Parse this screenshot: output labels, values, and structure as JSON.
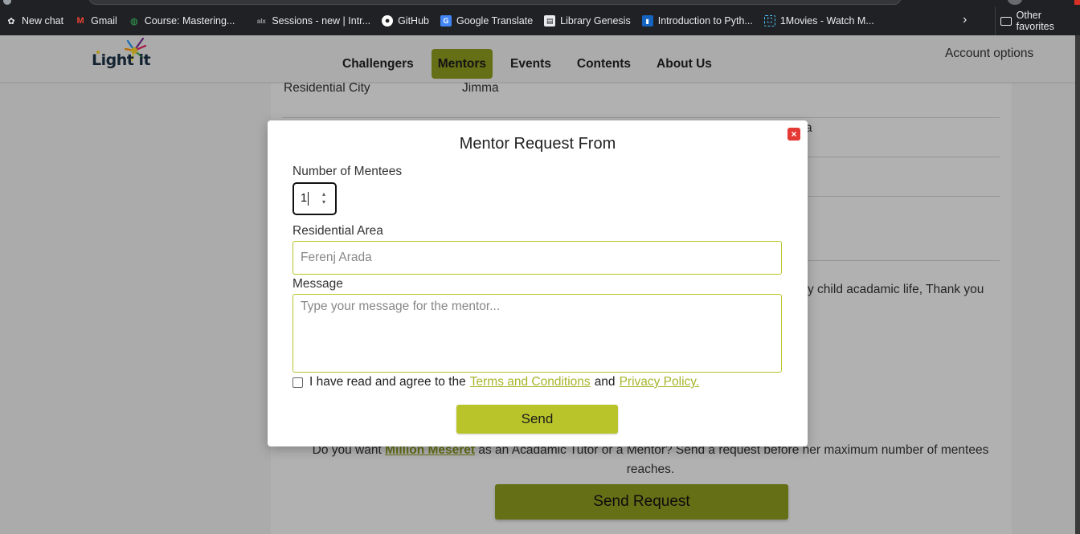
{
  "bookmarks": [
    {
      "label": "New chat",
      "icon": "openai-icon",
      "color": "#e8eaed"
    },
    {
      "label": "Gmail",
      "icon": "gmail-icon",
      "color": "#ea4335"
    },
    {
      "label": "Course: Mastering...",
      "icon": "globe-icon",
      "color": "#34a853"
    },
    {
      "label": "Sessions - new | Intr...",
      "icon": "alx-icon",
      "color": "#9aa0a6"
    },
    {
      "label": "GitHub",
      "icon": "github-icon",
      "color": "#ffffff"
    },
    {
      "label": "Google Translate",
      "icon": "translate-icon",
      "color": "#4285f4"
    },
    {
      "label": "Library Genesis",
      "icon": "book-icon",
      "color": "#e8eaed"
    },
    {
      "label": "Introduction to Pyth...",
      "icon": "edx-icon",
      "color": "#1565c0"
    },
    {
      "label": "1Movies - Watch M...",
      "icon": "movie-icon",
      "color": "#4fc3f7"
    }
  ],
  "other_favorites": "Other favorites",
  "site": {
    "logo_text": "Light it",
    "nav": [
      "Challengers",
      "Mentors",
      "Events",
      "Contents",
      "About Us"
    ],
    "active_nav": "Mentors",
    "account": "Account options",
    "accent": "#8c9a1f"
  },
  "profile": {
    "residential_city_label": "Residential City",
    "residential_city_value": "Jimma",
    "fragment_a": "a",
    "message_tail": "y child acadamic life, Thank you",
    "prompt_before": "Do you want ",
    "mentor_name": "Million Meseret",
    "prompt_after": " as an Acadamic Tutor or a Mentor? Send a request before her maximum number of mentees reaches.",
    "send_request": "Send Request"
  },
  "modal": {
    "title": "Mentor Request From",
    "close": "×",
    "mentees_label": "Number of Mentees",
    "mentees_value": "1",
    "area_label": "Residential Area",
    "area_placeholder": "Ferenj Arada",
    "message_label": "Message",
    "message_placeholder": "Type your message for the mentor...",
    "agree_text": "I have read and agree to the",
    "terms": "Terms and Conditions",
    "and": "and",
    "privacy": "Privacy Policy.",
    "send": "Send"
  }
}
